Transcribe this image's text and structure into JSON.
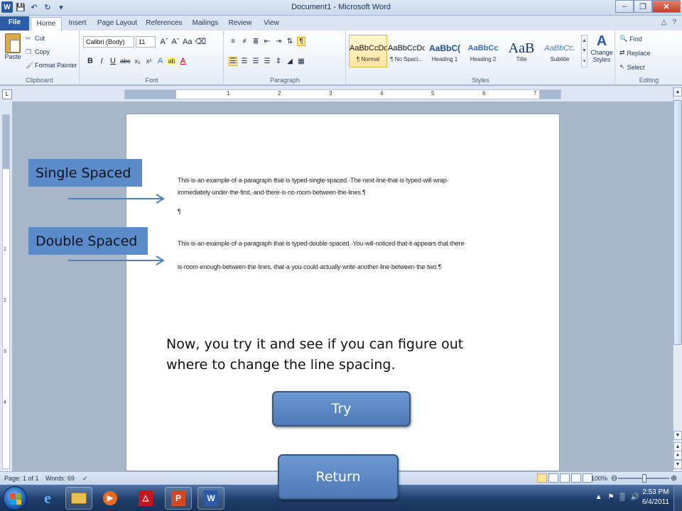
{
  "window": {
    "title": "Document1 - Microsoft Word",
    "app_icon": "W",
    "qat": [
      "save-icon",
      "undo-icon",
      "redo-icon",
      "customize-icon"
    ]
  },
  "tabs": [
    "File",
    "Home",
    "Insert",
    "Page Layout",
    "References",
    "Mailings",
    "Review",
    "View"
  ],
  "ribbon": {
    "clipboard": {
      "label": "Clipboard",
      "paste": "Paste",
      "cut": "Cut",
      "copy": "Copy",
      "format_painter": "Format Painter"
    },
    "font": {
      "label": "Font",
      "family": "Calibri (Body)",
      "size": "11"
    },
    "paragraph": {
      "label": "Paragraph"
    },
    "styles": {
      "label": "Styles",
      "items": [
        {
          "preview": "AaBbCcDc",
          "name": "¶ Normal"
        },
        {
          "preview": "AaBbCcDc",
          "name": "¶ No Spaci..."
        },
        {
          "preview": "AaBbC(",
          "name": "Heading 1"
        },
        {
          "preview": "AaBbCc",
          "name": "Heading 2"
        },
        {
          "preview": "AaB",
          "name": "Title"
        },
        {
          "preview": "AaBbCc.",
          "name": "Subtitle"
        }
      ],
      "change_styles": "Change Styles"
    },
    "editing": {
      "label": "Editing",
      "find": "Find",
      "replace": "Replace",
      "select": "Select"
    }
  },
  "document": {
    "single_line1": "This·is·an·example·of·a·paragraph·that·is·typed·single·spaced.·The·next·line·that·is·typed·will·wrap·",
    "single_line2": "immediately·under·the·first,·and·there·is·no·room·between·the·lines.¶",
    "pilcrow": "¶",
    "double_line1": "This·is·an·example·of·a·paragraph·that·is·typed·double·spaced.·You·will·noticed·that·it·appears·that·there·",
    "double_line2": "is·room·enough·between·the·lines,·that·a·you·could·actually·write·another·line·between·the·two.¶"
  },
  "overlay": {
    "single_label": "Single Spaced",
    "double_label": "Double Spaced",
    "instruction": "Now, you try it and see if you can figure out where to change the line spacing.",
    "try_button": "Try",
    "return_button": "Return"
  },
  "status": {
    "page": "Page: 1 of 1",
    "words": "Words: 69",
    "zoom": "100%"
  },
  "taskbar": {
    "time": "2:53 PM",
    "date": "6/4/2011"
  }
}
